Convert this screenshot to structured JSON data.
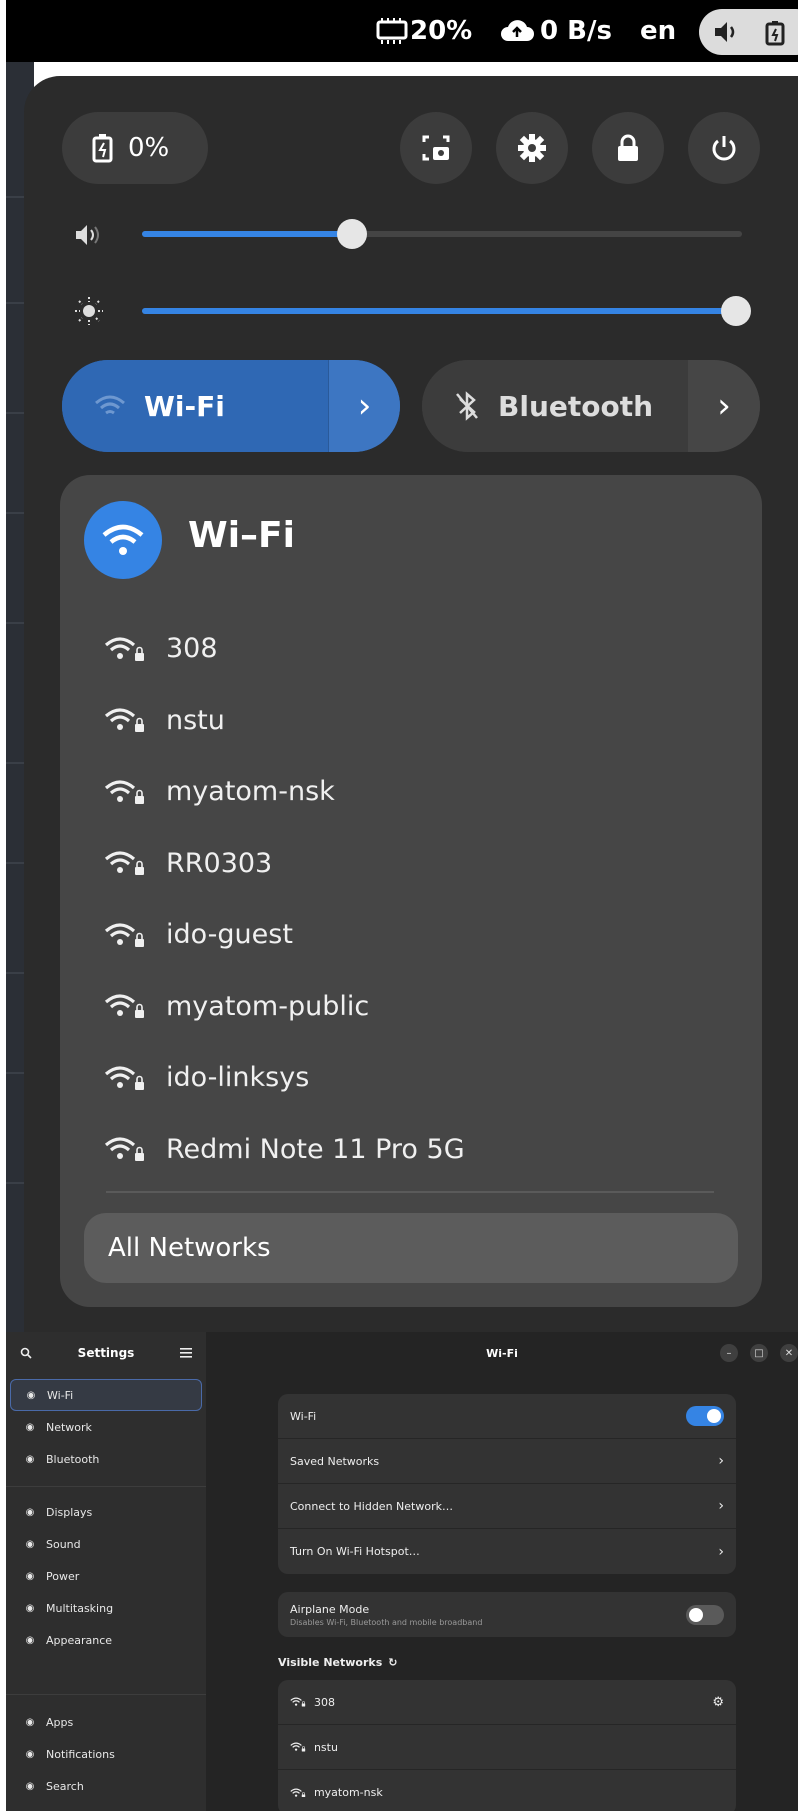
{
  "topbar": {
    "battery_text": "20%",
    "network_speed": "0 B/s",
    "language": "en",
    "icons": [
      "battery-icon",
      "cloud-upload-icon",
      "volume-icon",
      "power-indicator-icon"
    ]
  },
  "quick_settings": {
    "battery_label": "0%",
    "round_buttons": [
      "screenshot-icon",
      "gear-icon",
      "lock-icon",
      "power-icon"
    ],
    "volume_level": 0.35,
    "brightness_level": 0.99,
    "wifi_tile": {
      "label": "Wi-Fi",
      "active": true
    },
    "bluetooth_tile": {
      "label": "Bluetooth",
      "active": false
    },
    "wifi_menu": {
      "title": "Wi–Fi",
      "networks": [
        "308",
        "nstu",
        "myatom-nsk",
        "RR0303",
        "ido-guest",
        "myatom-public",
        "ido-linksys",
        "Redmi Note 11 Pro 5G"
      ],
      "all_networks": "All Networks"
    }
  },
  "settings": {
    "sidebar_title": "Settings",
    "window_title": "Wi-Fi",
    "sidebar": [
      {
        "label": "Wi-Fi",
        "icon": "wifi-icon",
        "active": true
      },
      {
        "label": "Network",
        "icon": "network-icon"
      },
      {
        "label": "Bluetooth",
        "icon": "bluetooth-icon"
      },
      {
        "label": "Displays",
        "icon": "display-icon"
      },
      {
        "label": "Sound",
        "icon": "sound-icon"
      },
      {
        "label": "Power",
        "icon": "power-icon"
      },
      {
        "label": "Multitasking",
        "icon": "multitasking-icon"
      },
      {
        "label": "Appearance",
        "icon": "appearance-icon"
      },
      {
        "label": "Apps",
        "icon": "apps-icon"
      },
      {
        "label": "Notifications",
        "icon": "bell-icon"
      },
      {
        "label": "Search",
        "icon": "search-icon"
      }
    ],
    "main": {
      "wifi_row": "Wi-Fi",
      "wifi_enabled": true,
      "saved_networks": "Saved Networks",
      "connect_hidden": "Connect to Hidden Network…",
      "hotspot": "Turn On Wi-Fi Hotspot…",
      "airplane_mode": "Airplane Mode",
      "airplane_sub": "Disables Wi-Fi, Bluetooth and mobile broadband",
      "airplane_enabled": false,
      "visible_networks_label": "Visible Networks",
      "visible_networks": [
        "308",
        "nstu",
        "myatom-nsk"
      ]
    }
  },
  "colors": {
    "accent": "#3584e4",
    "panel": "#2b2b2b",
    "card": "#464646"
  }
}
